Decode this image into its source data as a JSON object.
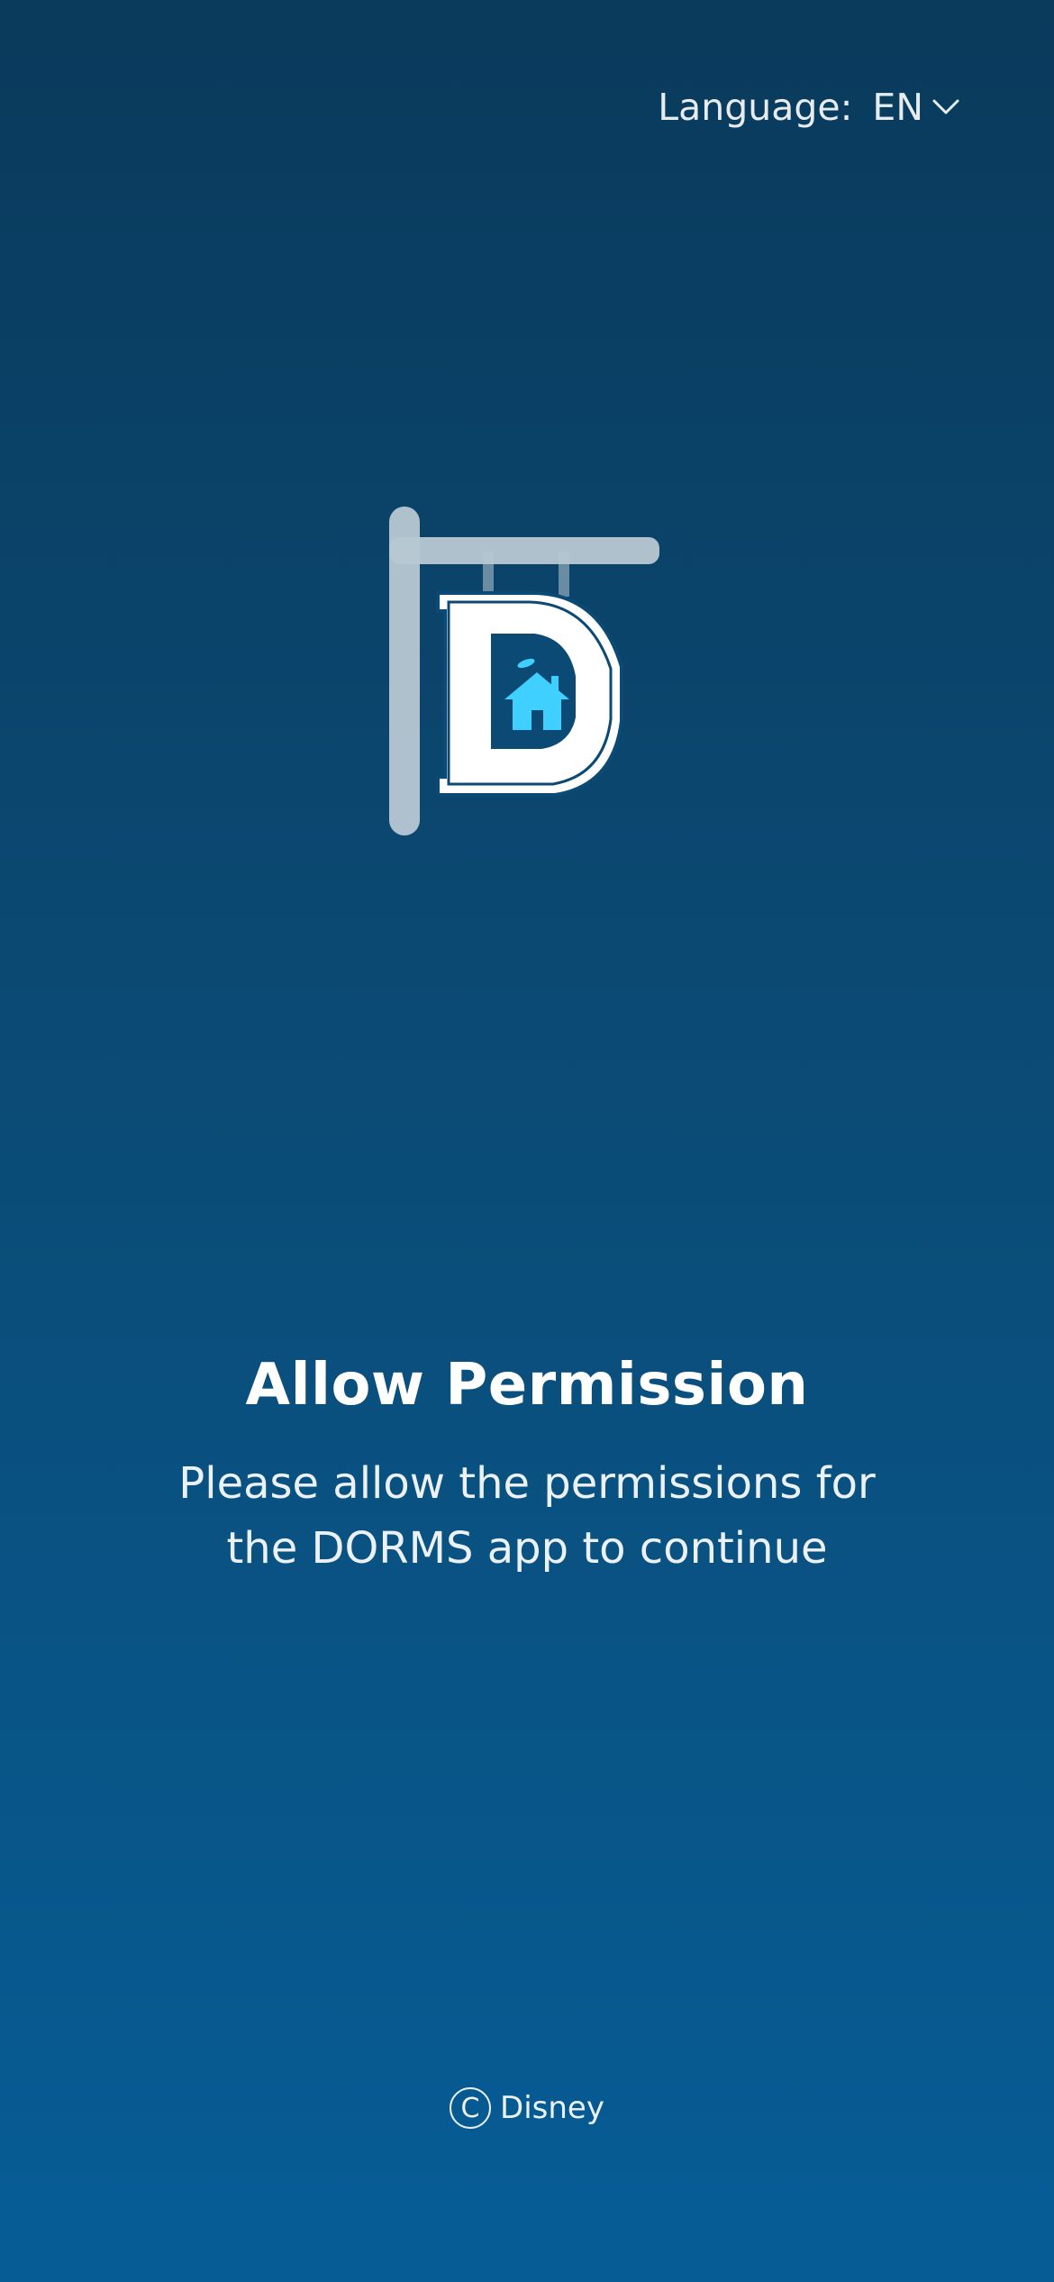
{
  "header": {
    "language_label": "Language:",
    "language_value": "EN"
  },
  "logo": {
    "name": "dorms-sign-logo",
    "accent_color": "#3fd0ff",
    "post_color": "#b8c8d3"
  },
  "main": {
    "title": "Allow Permission",
    "message": "Please allow the permissions for the DORMS app to continue"
  },
  "footer": {
    "copyright_symbol": "C",
    "brand": "Disney"
  },
  "colors": {
    "bg_top": "#0a3a5c",
    "bg_bottom": "#065d96"
  }
}
